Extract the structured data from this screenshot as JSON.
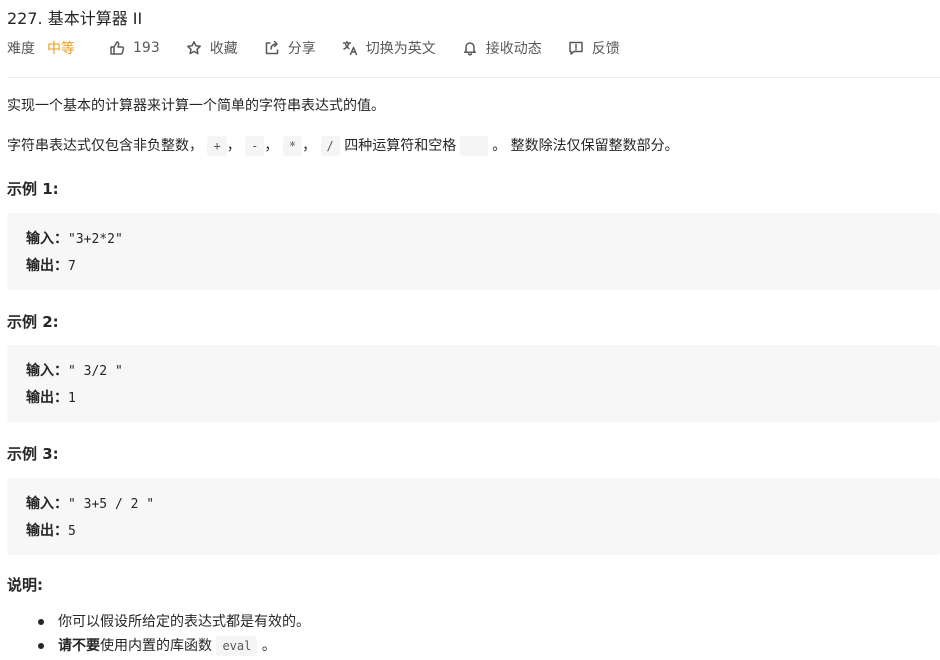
{
  "problem": {
    "title": "227. 基本计算器 II"
  },
  "meta": {
    "difficulty_label": "难度",
    "difficulty": "中等",
    "difficulty_color": "#ef9b18",
    "likes": "193",
    "favorite": "收藏",
    "share": "分享",
    "translate": "切换为英文",
    "subscribe": "接收动态",
    "feedback": "反馈",
    "icons": [
      "thumbs-up-icon",
      "star-icon",
      "share-icon",
      "translate-icon",
      "bell-icon",
      "feedback-icon"
    ]
  },
  "description": {
    "line1": "实现一个基本的计算器来计算一个简单的字符串表达式的值。",
    "line2_prefix": "字符串表达式仅包含非负整数，",
    "ops": [
      "+",
      "-",
      "*",
      "/"
    ],
    "sep1": "，",
    "sep2": "，",
    "sep3": "，",
    "line2_mid": "四种运算符和空格",
    "line2_suffix": "。 整数除法仅保留整数部分。"
  },
  "examples": [
    {
      "heading": "示例 1:",
      "input_label": "输入：",
      "input": "\"3+2*2\"",
      "output_label": "输出：",
      "output": "7"
    },
    {
      "heading": "示例 2:",
      "input_label": "输入：",
      "input": "\" 3/2 \"",
      "output_label": "输出：",
      "output": "1"
    },
    {
      "heading": "示例 3:",
      "input_label": "输入：",
      "input": "\" 3+5 / 2 \"",
      "output_label": "输出：",
      "output": "5"
    }
  ],
  "notes": {
    "heading": "说明:",
    "item1": "你可以假设所给定的表达式都是有效的。",
    "item2_bold": "请不要",
    "item2_text": "使用内置的库函数",
    "item2_code": "eval",
    "item2_end": "。"
  }
}
